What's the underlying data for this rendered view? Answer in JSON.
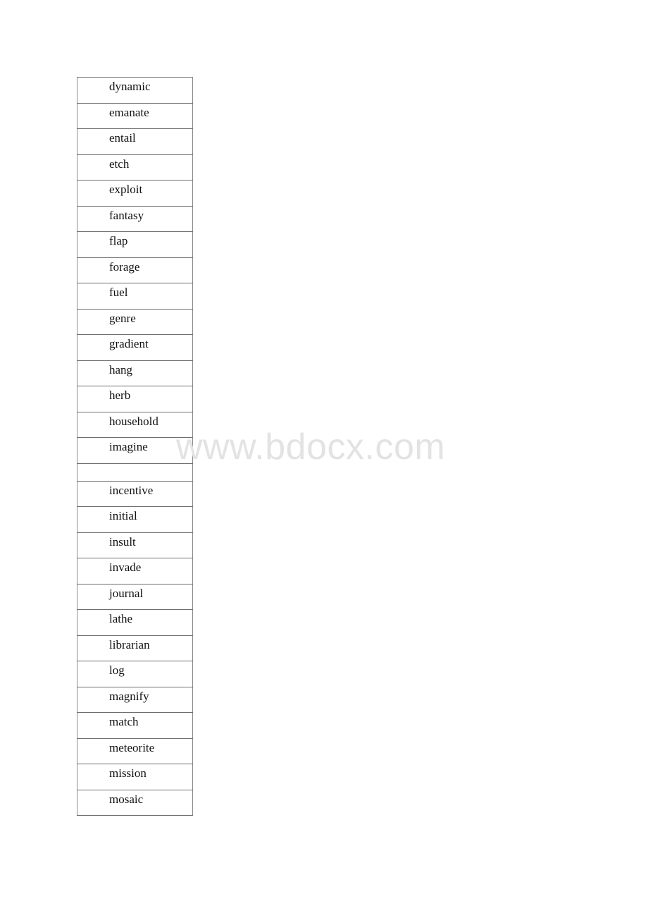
{
  "document": {
    "words": [
      "dynamic",
      "emanate",
      "entail",
      "etch",
      "exploit",
      "fantasy",
      "flap",
      "forage",
      "fuel",
      "genre",
      "gradient",
      "hang",
      "herb",
      "household",
      "imagine",
      "",
      "incentive",
      "initial",
      "insult",
      "invade",
      "journal",
      "lathe",
      "librarian",
      "log",
      "magnify",
      "match",
      "meteorite",
      "mission",
      "mosaic"
    ]
  },
  "watermark": {
    "text": "www.bdocx.com",
    "color": "#e3e3e3"
  }
}
